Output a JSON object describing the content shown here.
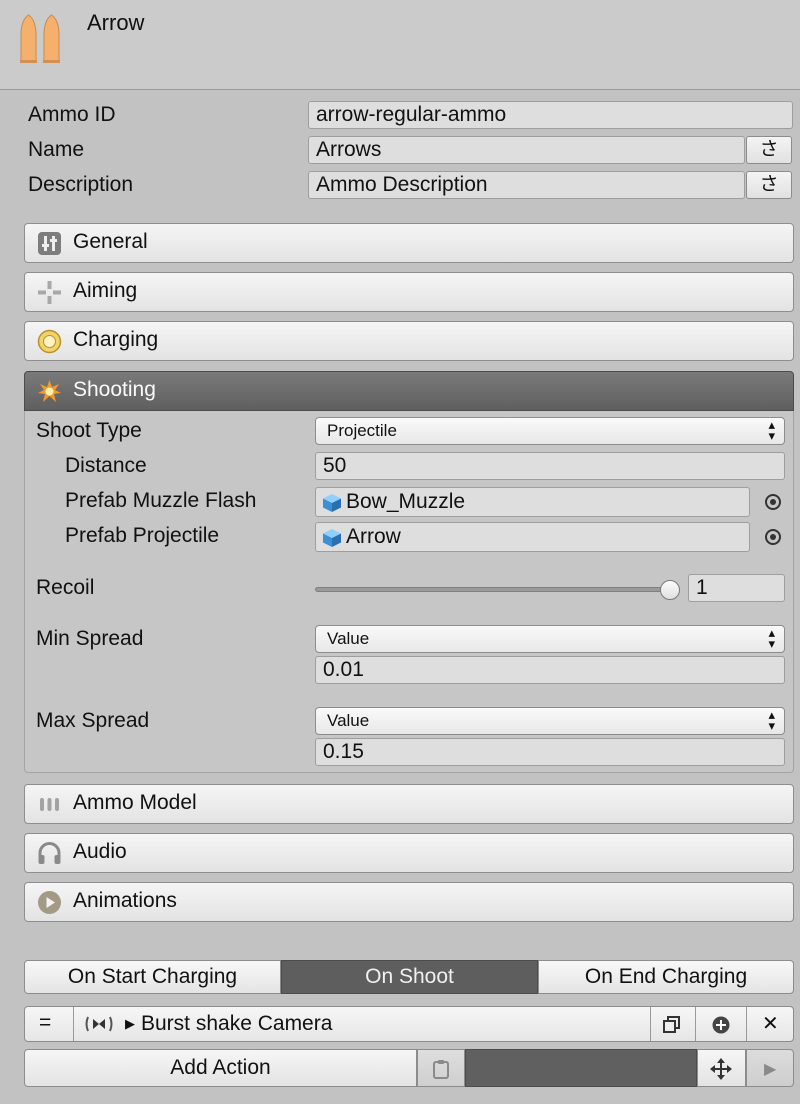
{
  "header": {
    "title": "Arrow",
    "icon": "ammo-bullets-icon"
  },
  "fields": {
    "ammo_id": {
      "label": "Ammo ID",
      "value": "arrow-regular-ammo"
    },
    "name": {
      "label": "Name",
      "value": "Arrows",
      "lang_button": "さ"
    },
    "description": {
      "label": "Description",
      "value": "Ammo Description",
      "lang_button": "さ"
    }
  },
  "sections": {
    "general": "General",
    "aiming": "Aiming",
    "charging": "Charging",
    "shooting": "Shooting",
    "ammo_model": "Ammo Model",
    "audio": "Audio",
    "animations": "Animations"
  },
  "shooting": {
    "shoot_type": {
      "label": "Shoot Type",
      "value": "Projectile"
    },
    "distance": {
      "label": "Distance",
      "value": "50"
    },
    "muzzle_flash": {
      "label": "Prefab Muzzle Flash",
      "value": "Bow_Muzzle"
    },
    "projectile": {
      "label": "Prefab Projectile",
      "value": "Arrow"
    },
    "recoil": {
      "label": "Recoil",
      "value": "1",
      "slider_fraction": 1.0
    },
    "min_spread": {
      "label": "Min Spread",
      "mode": "Value",
      "value": "0.01"
    },
    "max_spread": {
      "label": "Max Spread",
      "mode": "Value",
      "value": "0.15"
    }
  },
  "events": {
    "tabs": [
      "On Start Charging",
      "On Shoot",
      "On End Charging"
    ],
    "active_tab": "On Shoot",
    "action": {
      "handle": "=",
      "label": "Burst shake Camera"
    },
    "add_action": "Add Action"
  },
  "colors": {
    "background": "#c2c2c2",
    "active_header": "#6b6b6b",
    "bullet": "#f3b370"
  }
}
